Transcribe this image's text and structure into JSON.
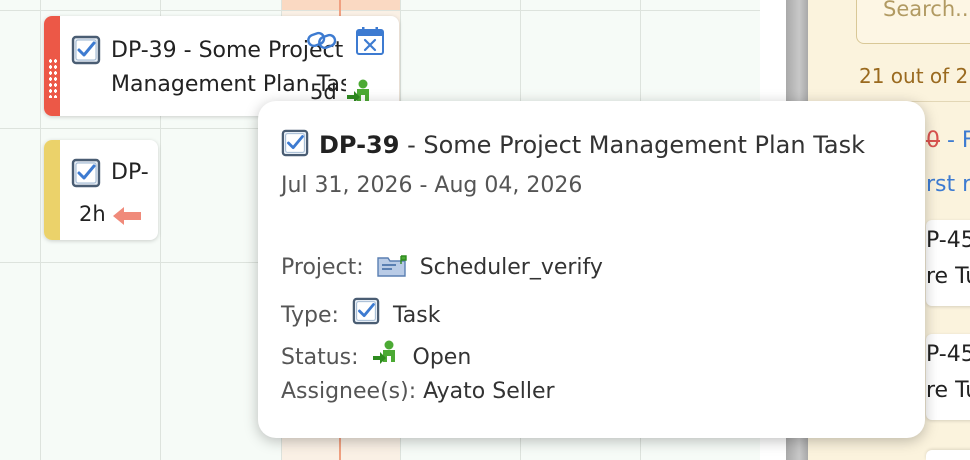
{
  "tasks": [
    {
      "title_line1": "DP-39 - Some Project",
      "title_line2": "Management Plan Task",
      "duration": "5d",
      "stripe_color": "#ec5847",
      "icons": [
        "task-checkbox-icon",
        "link-icon",
        "calendar-x-icon",
        "status-open-icon"
      ]
    },
    {
      "title": "DP-",
      "duration": "2h",
      "stripe_color": "#ebd26a",
      "icons": [
        "task-checkbox-icon",
        "left-arrow-icon"
      ]
    }
  ],
  "panel": {
    "search_placeholder": "Search...",
    "result_count": "21 out of 2",
    "fragment_red": "0",
    "fragment_dash": " - F",
    "fragment_blue": "rst ru",
    "list_cards": [
      {
        "code": "P-45",
        "name": "re Tu"
      },
      {
        "code": "P-45",
        "name": "re Tu"
      }
    ]
  },
  "tooltip": {
    "code": "DP-39",
    "title": "Some Project Management Plan Task",
    "dates": "Jul 31, 2026 - Aug 04, 2026",
    "project_label": "Project:",
    "project_value": "Scheduler_verify",
    "type_label": "Type:",
    "type_value": "Task",
    "status_label": "Status:",
    "status_value": "Open",
    "assignee_label": "Assignee(s):",
    "assignee_value": "Ayato Seller"
  },
  "colors": {
    "accent_blue": "#3d7bd1",
    "status_green": "#4caa34",
    "today_line": "#f0a081"
  }
}
